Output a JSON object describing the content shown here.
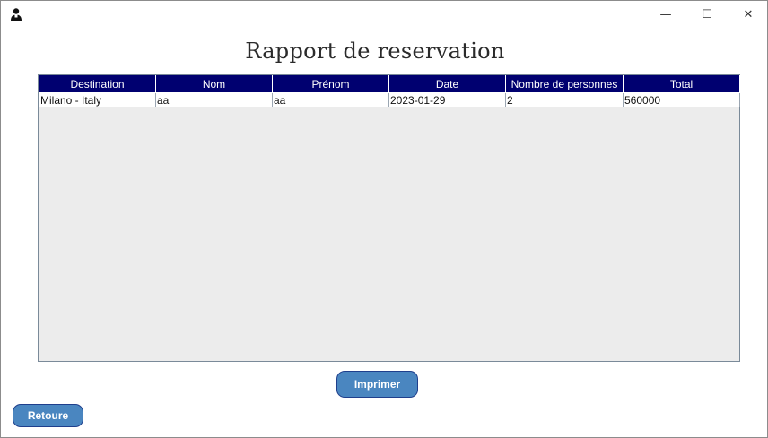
{
  "window": {
    "controls": {
      "minimize": "—",
      "maximize": "☐",
      "close": "✕"
    }
  },
  "report": {
    "title": "Rapport de reservation"
  },
  "table": {
    "columns": [
      "Destination",
      "Nom",
      "Prénom",
      "Date",
      "Nombre de personnes",
      "Total"
    ],
    "rows": [
      [
        "Milano - Italy",
        "aa",
        "aa",
        "2023-01-29",
        "2",
        "560000"
      ]
    ]
  },
  "actions": {
    "print_label": "Imprimer",
    "back_label": "Retoure"
  },
  "colors": {
    "header_bg": "#000070",
    "button_bg": "#4a86c0",
    "button_border": "#1f3f8c"
  }
}
